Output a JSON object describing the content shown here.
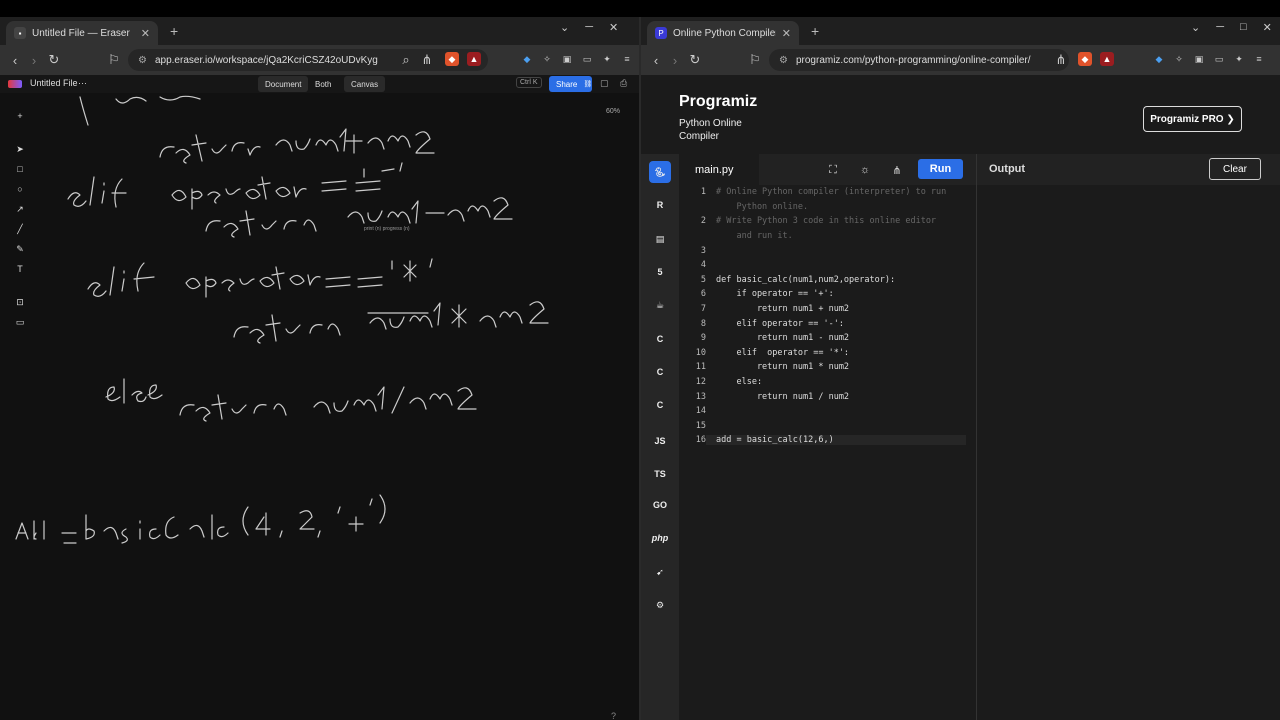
{
  "left_browser": {
    "tab_title": "Untitled File — Eraser",
    "url": "app.eraser.io/workspace/jQa2KcriCSZ42oUDvKyg"
  },
  "eraser": {
    "file_title": "Untitled File",
    "more": "···",
    "shortcut": "Ctrl K",
    "view_document": "Document",
    "view_both": "Both",
    "view_canvas": "Canvas",
    "share_label": "Share",
    "zoom_level": "60%",
    "help": "?",
    "ink_caption": "print (n) progress (n)"
  },
  "right_browser": {
    "tab_title": "Online Python Compiler (Int",
    "url": "programiz.com/python-programming/online-compiler/"
  },
  "programiz": {
    "logo": "Programiz",
    "subtitle": "Python Online Compiler",
    "pro_button": "Programiz PRO ❯",
    "file_tab": "main.py",
    "run_label": "Run",
    "output_label": "Output",
    "clear_label": "Clear",
    "languages": [
      "python-icon",
      "r-icon",
      "sql-icon",
      "html-icon",
      "java-icon",
      "c-icon",
      "cpp-icon",
      "csharp-icon",
      "js-icon",
      "ts-icon",
      "go-icon",
      "php-icon",
      "swift-icon",
      "rust-icon"
    ],
    "language_labels": {
      "js": "JS",
      "ts": "TS",
      "go": "GO",
      "php": "php"
    },
    "code_lines": [
      {
        "n": "1",
        "text": "# Online Python compiler (interpreter) to run",
        "cmt": true
      },
      {
        "n": "",
        "text": "    Python online.",
        "cmt": true
      },
      {
        "n": "2",
        "text": "# Write Python 3 code in this online editor",
        "cmt": true
      },
      {
        "n": "",
        "text": "    and run it.",
        "cmt": true
      },
      {
        "n": "3",
        "text": ""
      },
      {
        "n": "4",
        "text": ""
      },
      {
        "n": "5",
        "text": "def basic_calc(num1,num2,operator):"
      },
      {
        "n": "6",
        "text": "    if operator == '+':"
      },
      {
        "n": "7",
        "text": "        return num1 + num2"
      },
      {
        "n": "8",
        "text": "    elif operator == '-':"
      },
      {
        "n": "9",
        "text": "        return num1 - num2"
      },
      {
        "n": "10",
        "text": "    elif  operator == '*':"
      },
      {
        "n": "11",
        "text": "        return num1 * num2"
      },
      {
        "n": "12",
        "text": "    else:"
      },
      {
        "n": "13",
        "text": "        return num1 / num2"
      },
      {
        "n": "14",
        "text": ""
      },
      {
        "n": "15",
        "text": ""
      },
      {
        "n": "16",
        "text": "add = basic_calc(12,6,)",
        "active": true
      }
    ]
  }
}
